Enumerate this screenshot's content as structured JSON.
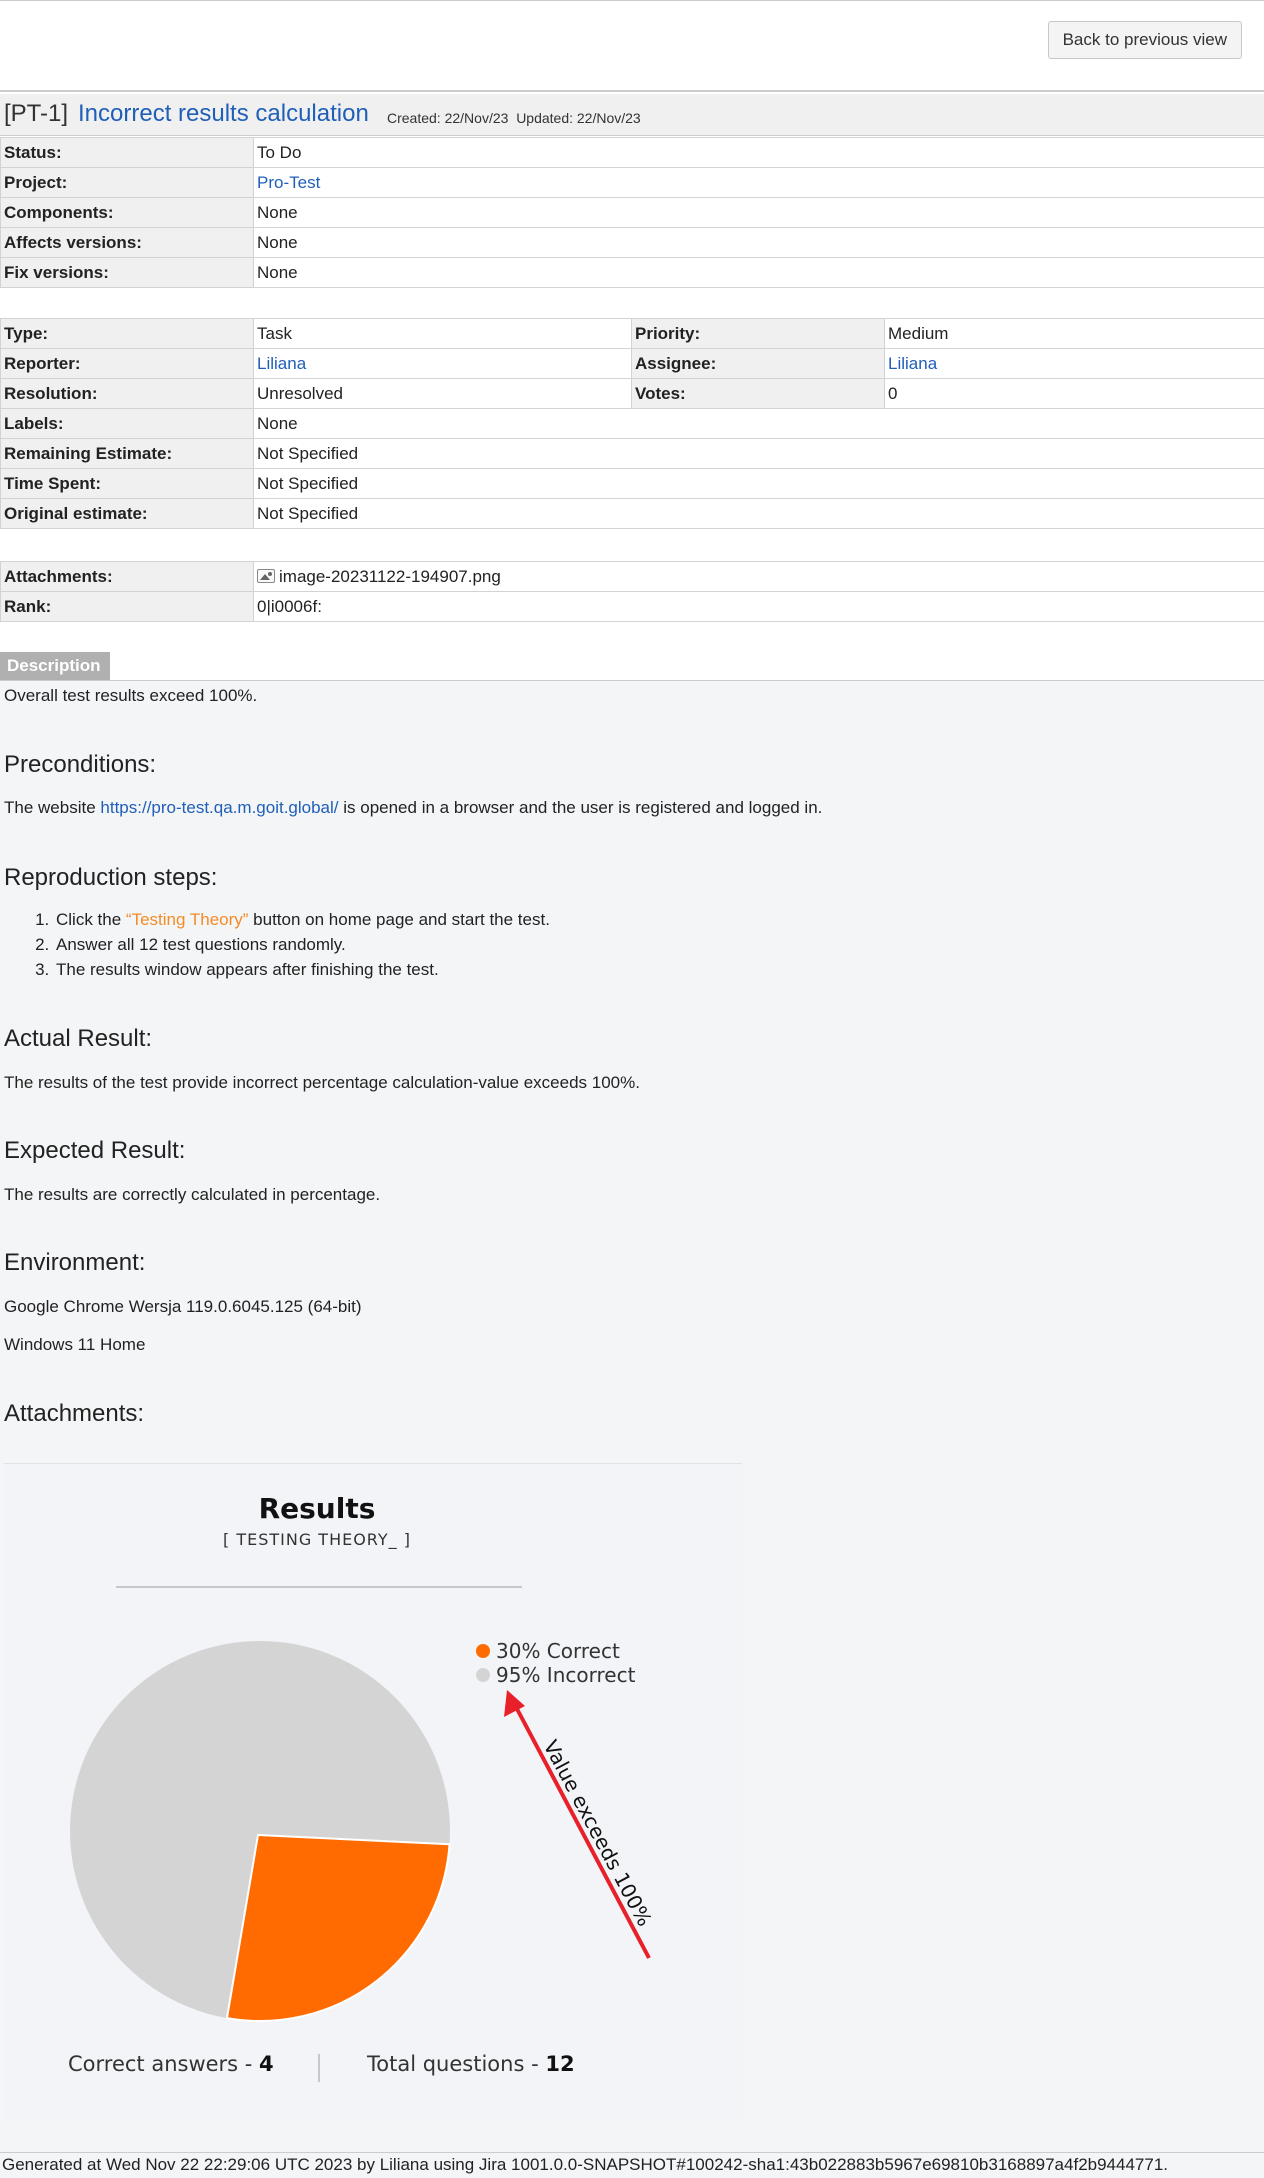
{
  "toolbar": {
    "back_label": "Back to previous view"
  },
  "issue": {
    "key": "[PT-1]",
    "summary": "Incorrect results calculation",
    "created": "Created: 22/Nov/23",
    "updated": "Updated: 22/Nov/23"
  },
  "fields_main": [
    {
      "label": "Status:",
      "value": "To Do"
    },
    {
      "label": "Project:",
      "value": "Pro-Test"
    },
    {
      "label": "Components:",
      "value": "None"
    },
    {
      "label": "Affects versions:",
      "value": "None"
    },
    {
      "label": "Fix versions:",
      "value": "None"
    }
  ],
  "fields_detail": {
    "type": {
      "label": "Type:",
      "value": "Task"
    },
    "priority": {
      "label": "Priority:",
      "value": "Medium"
    },
    "reporter": {
      "label": "Reporter:",
      "value": "Liliana"
    },
    "assignee": {
      "label": "Assignee:",
      "value": "Liliana"
    },
    "resolution": {
      "label": "Resolution:",
      "value": "Unresolved"
    },
    "votes": {
      "label": "Votes:",
      "value": "0"
    },
    "labels": {
      "label": "Labels:",
      "value": "None"
    },
    "remaining": {
      "label": "Remaining Estimate:",
      "value": "Not Specified"
    },
    "spent": {
      "label": "Time Spent:",
      "value": "Not Specified"
    },
    "original": {
      "label": "Original estimate:",
      "value": "Not Specified"
    }
  },
  "fields_extra": {
    "attachments": {
      "label": "Attachments:",
      "value": "image-20231122-194907.png",
      "icon": "image-icon"
    },
    "rank": {
      "label": "Rank:",
      "value": "0|i0006f:"
    }
  },
  "description": {
    "tab_label": "Description",
    "intro": "Overall test results exceed 100%.",
    "preconditions_heading": "Preconditions:",
    "preconditions_before": "The website ",
    "preconditions_link": "https://pro-test.qa.m.goit.global/",
    "preconditions_after": " is opened in a browser and the user is registered and logged in.",
    "steps_heading": "Reproduction steps:",
    "steps": {
      "s1_before": "Click the ",
      "s1_highlight": "“Testing Theory”",
      "s1_after": " button on home page and start the test.",
      "s2": "Answer all 12 test questions randomly.",
      "s3": "The results window appears after finishing the test."
    },
    "actual_heading": "Actual Result:",
    "actual_text": "The results of the test provide incorrect percentage calculation-value exceeds 100%.",
    "expected_heading": "Expected Result:",
    "expected_text": "The results are correctly calculated in percentage.",
    "environment_heading": "Environment:",
    "environment_lines": [
      "Google Chrome Wersja 119.0.6045.125 (64-bit)",
      "Windows 11 Home"
    ],
    "attachments_heading": "Attachments:"
  },
  "screenshot": {
    "title": "Results",
    "subtitle": "[ TESTING THEORY_ ]",
    "legend": [
      {
        "label": "30% Correct",
        "color": "#ff6b00"
      },
      {
        "label": "95% Incorrect",
        "color": "#d4d4d4"
      }
    ],
    "annotation": "Value exceeds 100%",
    "annotation_color": "#e8202a",
    "correct_label": "Correct answers - ",
    "correct_value": "4",
    "total_label": "Total questions - ",
    "total_value": "12",
    "pie": {
      "correct_fraction": 0.2667,
      "correct_color": "#ff6b00",
      "incorrect_color": "#d4d4d4"
    }
  },
  "footer": {
    "generated": "Generated at Wed Nov 22 22:29:06 UTC 2023 by Liliana using Jira 1001.0.0-SNAPSHOT#100242-sha1:43b022883b5967e69810b3168897a4f2b9444771."
  }
}
